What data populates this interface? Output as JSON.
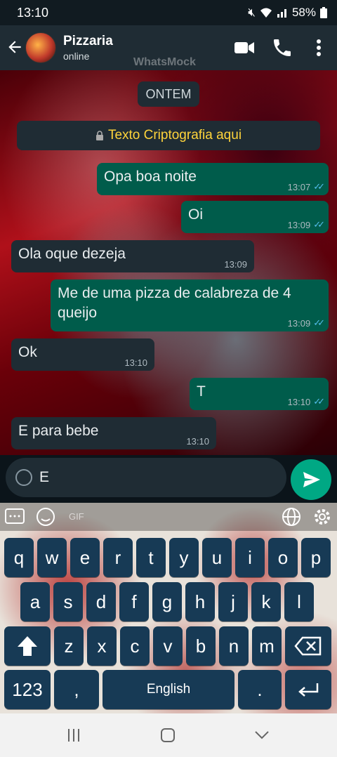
{
  "status_bar": {
    "time": "13:10",
    "battery": "58%"
  },
  "header": {
    "contact_name": "Pizzaria",
    "status": "online",
    "watermark": "WhatsMock"
  },
  "chat": {
    "date_chip": "ONTEM",
    "encryption_notice": "Texto Criptografia aqui",
    "messages": [
      {
        "direction": "out",
        "text": "Opa boa noite",
        "time": "13:07"
      },
      {
        "direction": "out",
        "text": "Oi",
        "time": "13:09"
      },
      {
        "direction": "in",
        "text": "Ola oque dezeja",
        "time": "13:09"
      },
      {
        "direction": "out",
        "text": "Me de uma pizza de calabreza de 4",
        "text2": "queijo",
        "time": "13:09"
      },
      {
        "direction": "in",
        "text": "Ok",
        "time": "13:10"
      },
      {
        "direction": "out",
        "text": "T",
        "time": "13:10"
      },
      {
        "direction": "in",
        "text": "E para bebe",
        "time": "13:10"
      }
    ]
  },
  "input": {
    "value": "E"
  },
  "keyboard": {
    "toolbar_gif": "GIF",
    "row1": [
      "q",
      "w",
      "e",
      "r",
      "t",
      "y",
      "u",
      "i",
      "o",
      "p"
    ],
    "row2": [
      "a",
      "s",
      "d",
      "f",
      "g",
      "h",
      "j",
      "k",
      "l"
    ],
    "row3": [
      "z",
      "x",
      "c",
      "v",
      "b",
      "n",
      "m"
    ],
    "numbers_key": "123",
    "comma_key": ",",
    "space_label": "English",
    "period_key": "."
  },
  "colors": {
    "outgoing_bubble": "#005c4b",
    "incoming_bubble": "#1f2c34",
    "accent": "#00a884",
    "key": "#173a55"
  }
}
